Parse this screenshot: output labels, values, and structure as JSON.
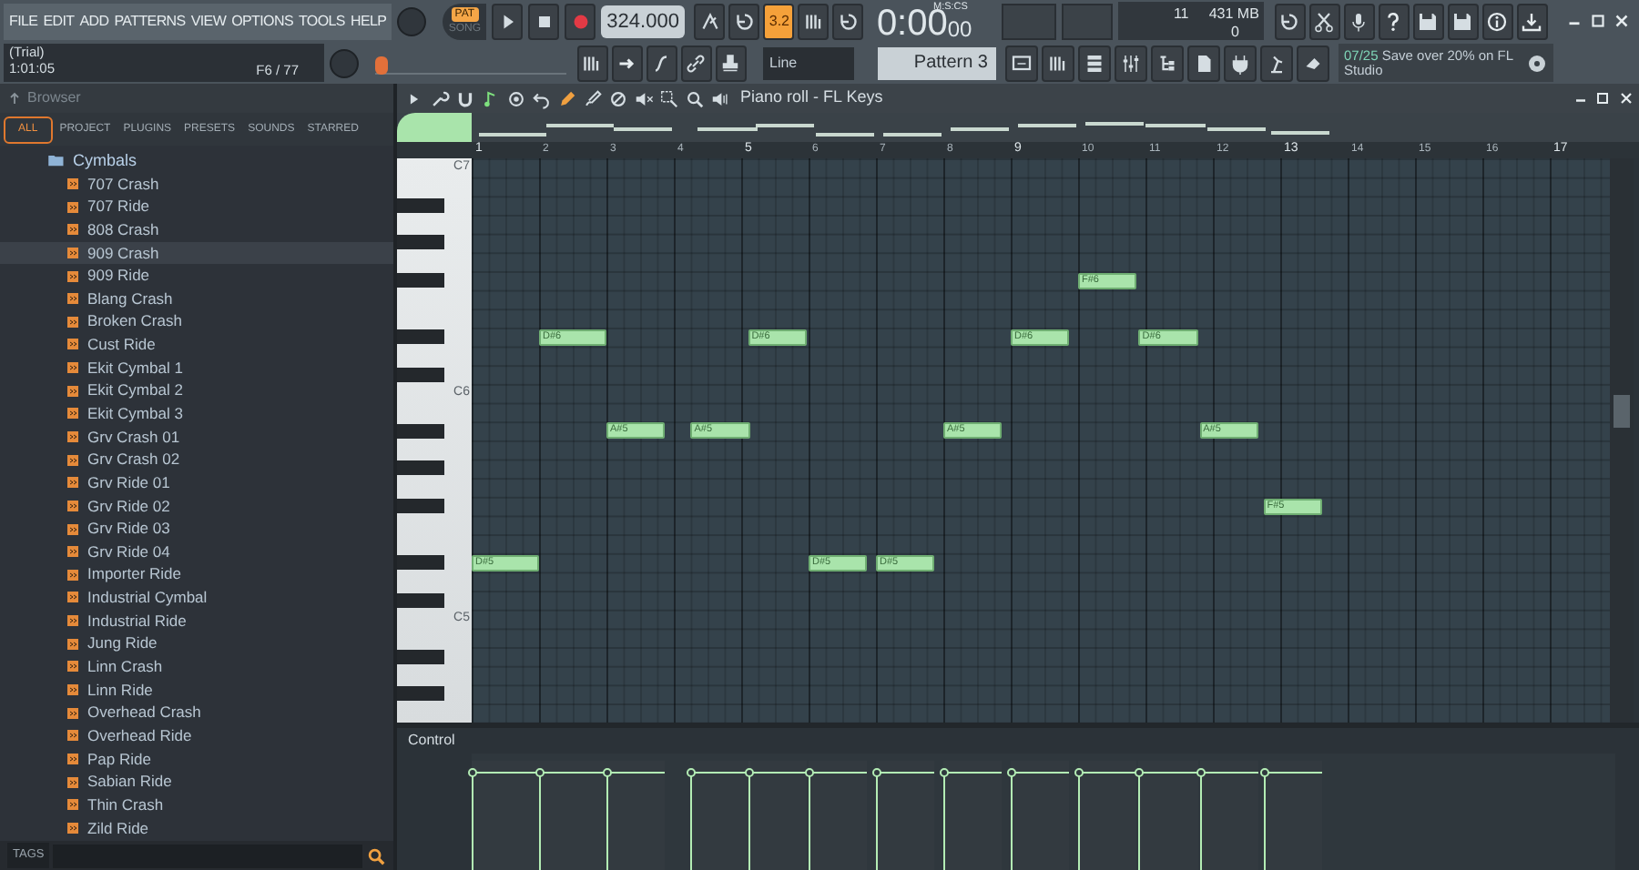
{
  "menu": [
    "FILE",
    "EDIT",
    "ADD",
    "PATTERNS",
    "VIEW",
    "OPTIONS",
    "TOOLS",
    "HELP"
  ],
  "hint_panel": {
    "status": "(Trial)",
    "time": "1:01:05",
    "position": "F6 / 77"
  },
  "transport": {
    "modes": [
      {
        "label": "PAT",
        "selected": true
      },
      {
        "label": "SONG",
        "selected": false
      }
    ],
    "tempo": "324.000"
  },
  "snap_button": {
    "label": "3.2",
    "on": true
  },
  "time_display": {
    "unit": "M:S:CS",
    "value": "0:00",
    "fraction": "00"
  },
  "cpu": {
    "value": "11",
    "memory": "431 MB",
    "polyphony": "0"
  },
  "song_position": {
    "level": 0
  },
  "snap": "Line",
  "pattern": "Pattern 3",
  "news": {
    "date": "07/25",
    "text": "Save over 20% on FL Studio"
  },
  "browser": {
    "title": "Browser",
    "tabs": [
      {
        "label": "ALL",
        "selected": true
      },
      {
        "label": "PROJECT",
        "selected": false
      },
      {
        "label": "PLUGINS",
        "selected": false
      },
      {
        "label": "PRESETS",
        "selected": false
      },
      {
        "label": "SOUNDS",
        "selected": false
      },
      {
        "label": "STARRED",
        "selected": false
      }
    ],
    "folder": "Cymbals",
    "items": [
      {
        "label": "707 Crash",
        "selected": false
      },
      {
        "label": "707 Ride",
        "selected": false
      },
      {
        "label": "808 Crash",
        "selected": false
      },
      {
        "label": "909 Crash",
        "selected": true
      },
      {
        "label": "909 Ride",
        "selected": false
      },
      {
        "label": "Blang Crash",
        "selected": false
      },
      {
        "label": "Broken Crash",
        "selected": false
      },
      {
        "label": "Cust Ride",
        "selected": false
      },
      {
        "label": "Ekit Cymbal 1",
        "selected": false
      },
      {
        "label": "Ekit Cymbal 2",
        "selected": false
      },
      {
        "label": "Ekit Cymbal 3",
        "selected": false
      },
      {
        "label": "Grv Crash 01",
        "selected": false
      },
      {
        "label": "Grv Crash 02",
        "selected": false
      },
      {
        "label": "Grv Ride 01",
        "selected": false
      },
      {
        "label": "Grv Ride 02",
        "selected": false
      },
      {
        "label": "Grv Ride 03",
        "selected": false
      },
      {
        "label": "Grv Ride 04",
        "selected": false
      },
      {
        "label": "Importer Ride",
        "selected": false
      },
      {
        "label": "Industrial Cymbal",
        "selected": false
      },
      {
        "label": "Industrial Ride",
        "selected": false
      },
      {
        "label": "Jung Ride",
        "selected": false
      },
      {
        "label": "Linn Crash",
        "selected": false
      },
      {
        "label": "Linn Ride",
        "selected": false
      },
      {
        "label": "Overhead Crash",
        "selected": false
      },
      {
        "label": "Overhead Ride",
        "selected": false
      },
      {
        "label": "Pap Ride",
        "selected": false
      },
      {
        "label": "Sabian Ride",
        "selected": false
      },
      {
        "label": "Thin Crash",
        "selected": false
      },
      {
        "label": "Zild Ride",
        "selected": false
      }
    ],
    "tags": "TAGS"
  },
  "piano_roll": {
    "title": "Piano roll - FL Keys",
    "ruler": [
      {
        "label": "1",
        "major": true
      },
      {
        "label": "2",
        "major": false
      },
      {
        "label": "3",
        "major": false
      },
      {
        "label": "4",
        "major": false
      },
      {
        "label": "5",
        "major": true
      },
      {
        "label": "6",
        "major": false
      },
      {
        "label": "7",
        "major": false
      },
      {
        "label": "8",
        "major": false
      },
      {
        "label": "9",
        "major": true
      },
      {
        "label": "10",
        "major": false
      },
      {
        "label": "11",
        "major": false
      },
      {
        "label": "12",
        "major": false
      },
      {
        "label": "13",
        "major": true
      },
      {
        "label": "14",
        "major": false
      },
      {
        "label": "15",
        "major": false
      },
      {
        "label": "16",
        "major": false
      },
      {
        "label": "17",
        "major": true
      }
    ],
    "key_labels": [
      "C7",
      "C6",
      "C5"
    ],
    "notes": [
      {
        "label": "D#5",
        "level": 0.9
      },
      {
        "label": "D#6",
        "level": 0.9
      },
      {
        "label": "A#5",
        "level": 0.9
      },
      {
        "label": "A#5",
        "level": 0.9
      },
      {
        "label": "D#6",
        "level": 0.9
      },
      {
        "label": "D#5",
        "level": 0.9
      },
      {
        "label": "D#5",
        "level": 0.9
      },
      {
        "label": "A#5",
        "level": 0.9
      },
      {
        "label": "D#6",
        "level": 0.9
      },
      {
        "label": "F#6",
        "level": 0.9
      },
      {
        "label": "D#6",
        "level": 0.9
      },
      {
        "label": "A#5",
        "level": 0.9
      },
      {
        "label": "F#5",
        "level": 0.9
      }
    ],
    "control_label": "Control"
  }
}
